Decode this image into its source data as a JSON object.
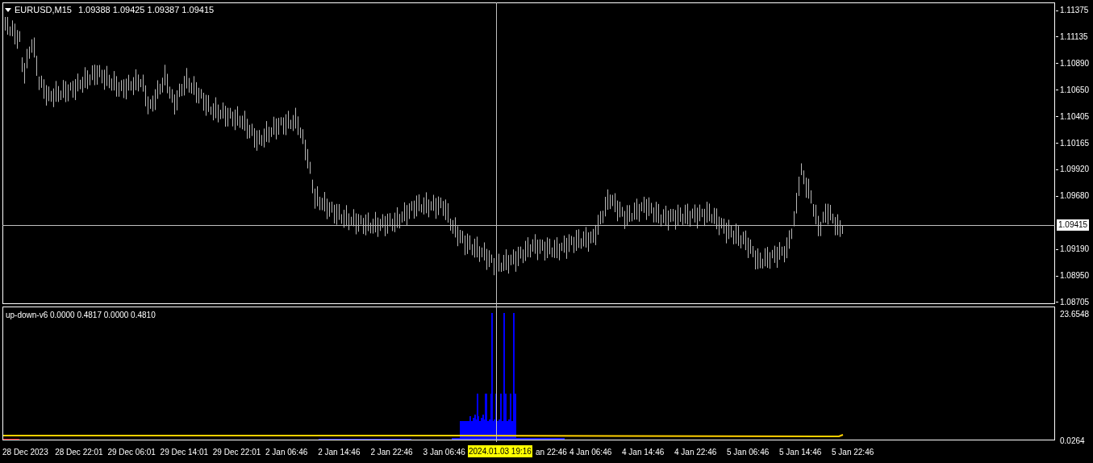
{
  "chart": {
    "symbol_caption": "EURUSD,M15",
    "ohlc": "1.09388 1.09425 1.09387 1.09415",
    "price_labels": [
      "1.11375",
      "1.11135",
      "1.10890",
      "1.10650",
      "1.10405",
      "1.10165",
      "1.09920",
      "1.09680",
      "1.09190",
      "1.08950",
      "1.08705"
    ],
    "current_price": "1.09415",
    "indicator": {
      "caption": "up-down-v6 0.0000 0.4817 0.0000 0.4810",
      "scale_max": "23.6548",
      "scale_min": "0.0264"
    },
    "time_labels": [
      "28 Dec 2023",
      "28 Dec 22:01",
      "29 Dec 06:01",
      "29 Dec 14:01",
      "29 Dec 22:01",
      "2 Jan 06:46",
      "2 Jan 14:46",
      "2 Jan 22:46",
      "3 Jan 06:46",
      "an 22:46",
      "4 Jan 06:46",
      "4 Jan 14:46",
      "4 Jan 22:46",
      "5 Jan 06:46",
      "5 Jan 14:46",
      "5 Jan 22:46"
    ],
    "crosshair_time": "2024.01.03 19:16"
  }
}
